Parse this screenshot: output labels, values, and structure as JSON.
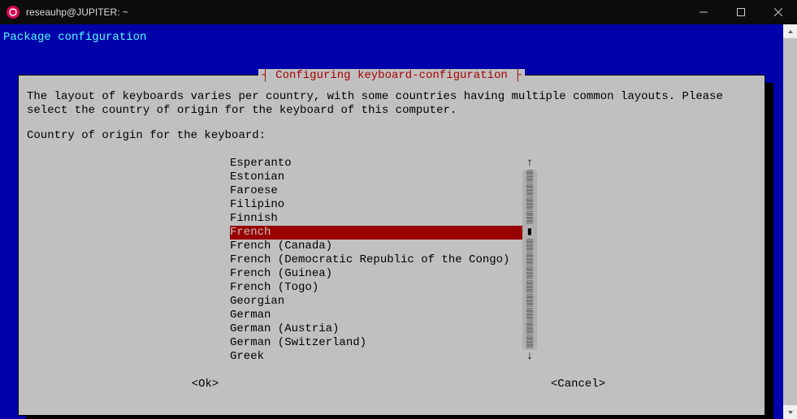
{
  "window": {
    "title": "reseauhp@JUPITER: ~"
  },
  "header": "Package configuration",
  "dialog": {
    "title": "┤ Configuring keyboard-configuration ├",
    "instruction": "The layout of keyboards varies per country, with some countries having multiple common layouts. Please select the country of origin for the keyboard of this computer.",
    "prompt": "Country of origin for the keyboard:",
    "items": [
      "Esperanto",
      "Estonian",
      "Faroese",
      "Filipino",
      "Finnish",
      "French",
      "French (Canada)",
      "French (Democratic Republic of the Congo)",
      "French (Guinea)",
      "French (Togo)",
      "Georgian",
      "German",
      "German (Austria)",
      "German (Switzerland)",
      "Greek"
    ],
    "selected_index": 5,
    "scroll_up": "↑",
    "scroll_down": "↓",
    "ok": "<Ok>",
    "cancel": "<Cancel>"
  }
}
